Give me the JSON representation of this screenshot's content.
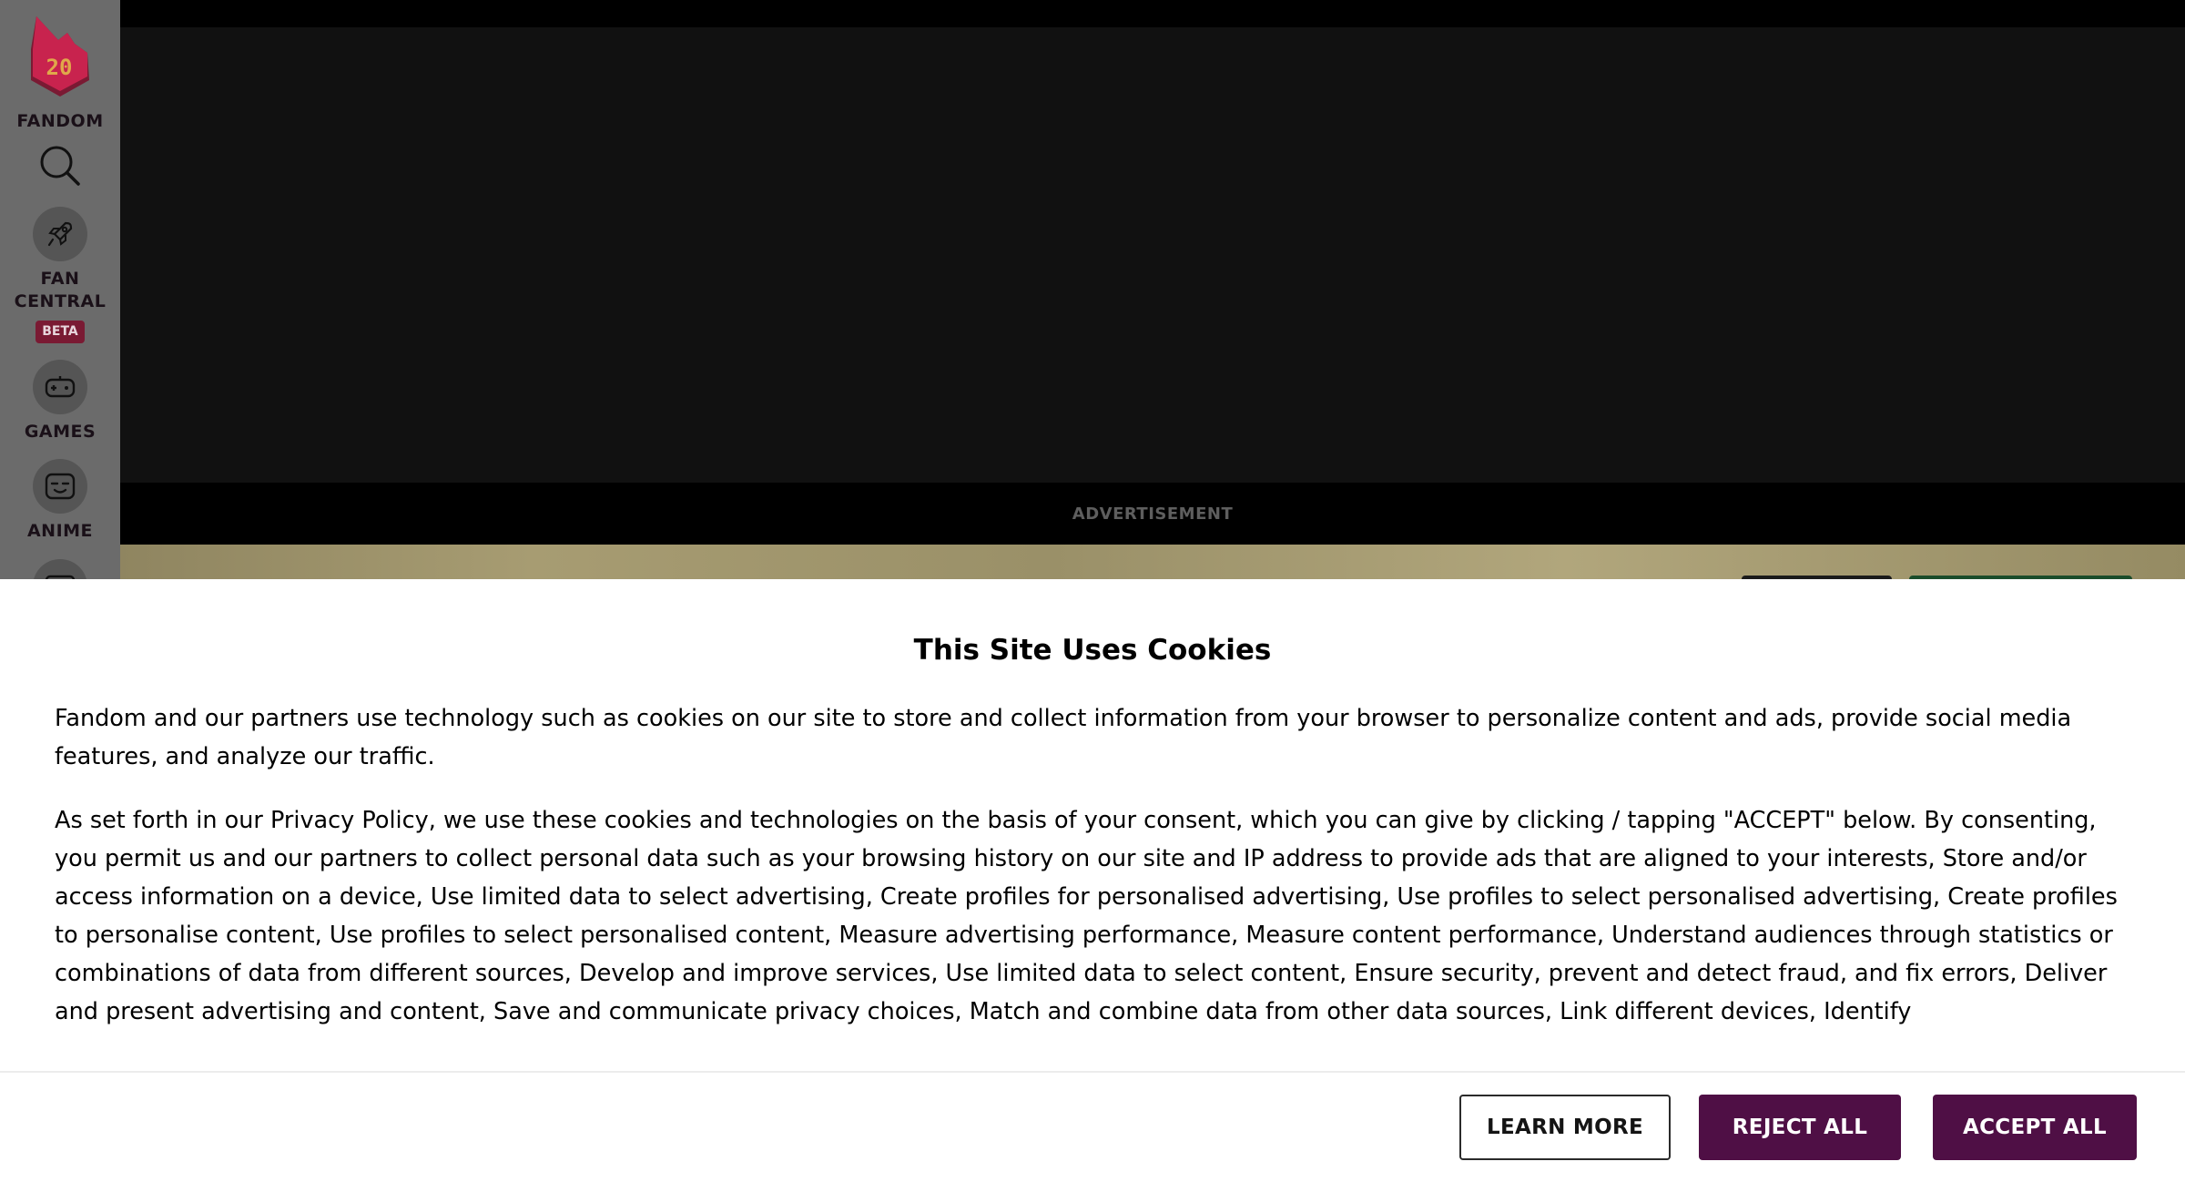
{
  "sidebar": {
    "logo_text": "20",
    "brand": "FANDOM",
    "items": [
      {
        "label": "FAN",
        "label2": "CENTRAL",
        "badge": "BETA",
        "icon": "rocket-icon"
      },
      {
        "label": "GAMES",
        "icon": "gamepad-icon"
      },
      {
        "label": "ANIME",
        "icon": "anime-face-icon"
      }
    ],
    "search_icon": "search-icon"
  },
  "ad": {
    "label": "ADVERTISEMENT"
  },
  "cookie_banner": {
    "title": "This Site Uses Cookies",
    "paragraph1": "Fandom and our partners use technology such as cookies on our site to store and collect information from your browser to personalize content and ads, provide social media features, and analyze our traffic.",
    "paragraph2": "As set forth in our Privacy Policy, we use these cookies and technologies on the basis of your consent, which you can give by clicking / tapping \"ACCEPT\" below. By consenting, you permit us and our partners to collect personal data such as your browsing history on our site and IP address to provide ads that are aligned to your interests, Store and/or access information on a device, Use limited data to select advertising, Create profiles for personalised advertising, Use profiles to select personalised advertising, Create profiles to personalise content, Use profiles to select personalised content, Measure advertising performance, Measure content performance, Understand audiences through statistics or combinations of data from different sources, Develop and improve services, Use limited data to select content, Ensure security, prevent and detect fraud, and fix errors, Deliver and present advertising and content, Save and communicate privacy choices, Match and combine data from other data sources, Link different devices, Identify",
    "buttons": {
      "learn_more": "LEARN MORE",
      "reject_all": "REJECT ALL",
      "accept_all": "ACCEPT ALL"
    }
  },
  "colors": {
    "brand_red": "#c8234e",
    "button_purple": "#4f0f45",
    "rail_gray": "#6b6b6b"
  }
}
